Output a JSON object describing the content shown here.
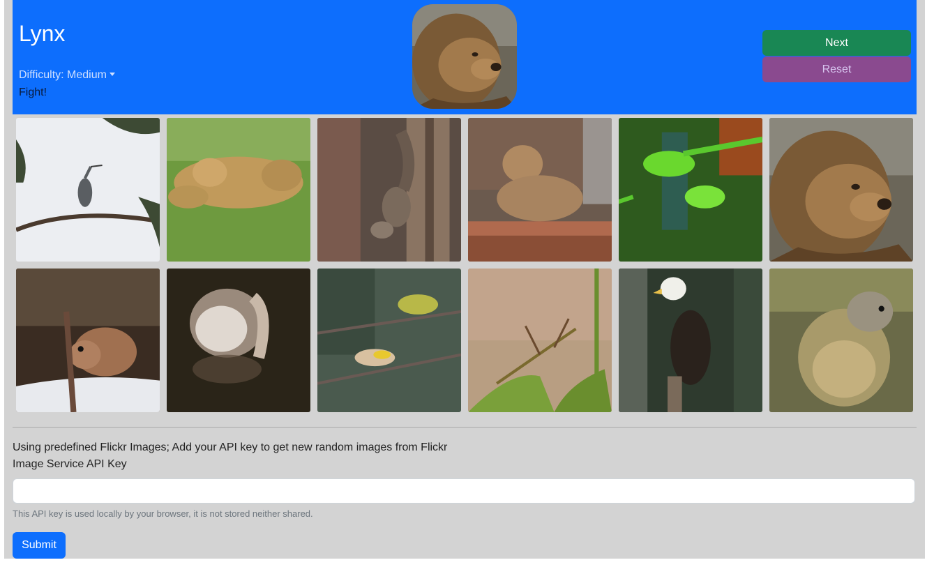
{
  "header": {
    "title": "Lynx",
    "difficulty_label": "Difficulty: Medium",
    "status": "Fight!",
    "next_label": "Next",
    "reset_label": "Reset",
    "target_image": "lion"
  },
  "grid": {
    "tiles": [
      {
        "subject": "heron"
      },
      {
        "subject": "lions"
      },
      {
        "subject": "squirrel"
      },
      {
        "subject": "lynx"
      },
      {
        "subject": "parakeets"
      },
      {
        "subject": "lion"
      },
      {
        "subject": "vole"
      },
      {
        "subject": "swan"
      },
      {
        "subject": "finches"
      },
      {
        "subject": "insect"
      },
      {
        "subject": "eagle"
      },
      {
        "subject": "marmot"
      }
    ]
  },
  "footer": {
    "info_text": "Using predefined Flickr Images; Add your API key to get new random images from Flickr",
    "key_label": "Image Service API Key",
    "key_value": "",
    "help_text": "This API key is used locally by your browser, it is not stored neither shared.",
    "submit_label": "Submit"
  },
  "colors": {
    "header_bg": "#0d6efd",
    "next_bg": "#198754",
    "reset_bg": "#8a4a8f",
    "page_bg": "#d3d3d3"
  }
}
